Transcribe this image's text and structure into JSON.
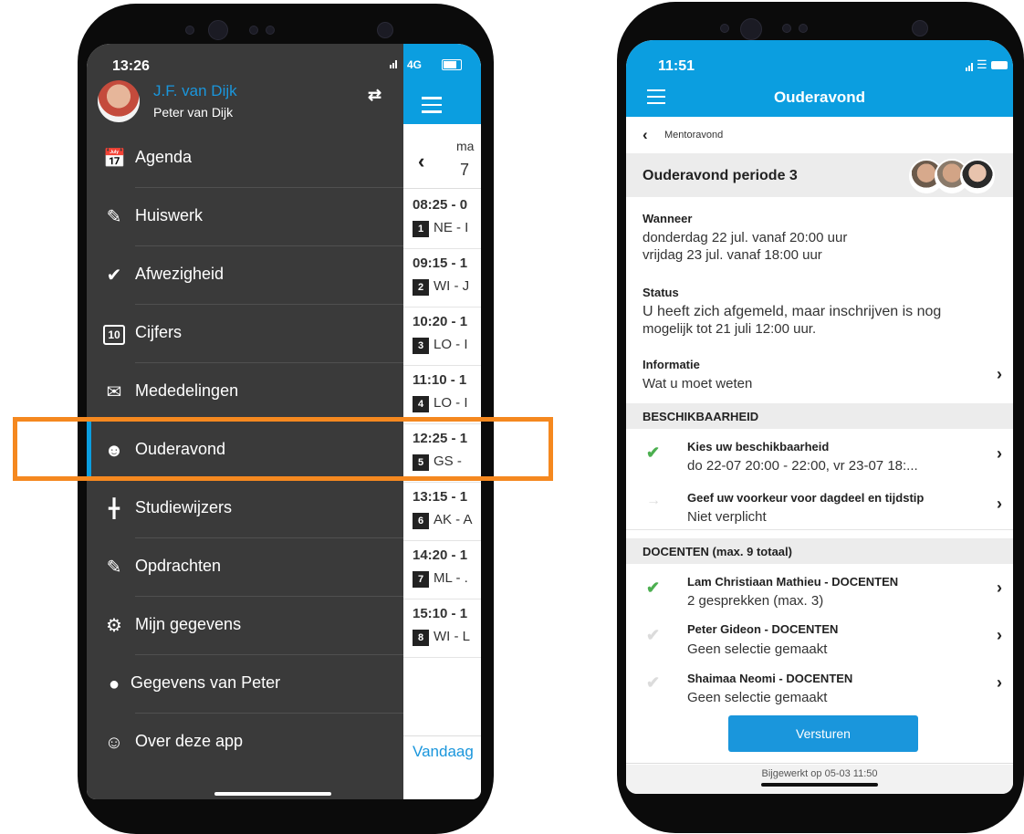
{
  "left_phone": {
    "status": {
      "time": "13:26",
      "network": "4G"
    },
    "profile": {
      "name": "J.F. van Dijk",
      "child": "Peter van Dijk"
    },
    "menu": [
      {
        "label": "Agenda",
        "icon": "calendar-icon"
      },
      {
        "label": "Huiswerk",
        "icon": "edit-icon"
      },
      {
        "label": "Afwezigheid",
        "icon": "check-circle-icon"
      },
      {
        "label": "Cijfers",
        "icon": "grades-icon"
      },
      {
        "label": "Mededelingen",
        "icon": "envelope-icon"
      },
      {
        "label": "Ouderavond",
        "icon": "parents-chat-icon",
        "active": true
      },
      {
        "label": "Studiewijzers",
        "icon": "signpost-icon"
      },
      {
        "label": "Opdrachten",
        "icon": "assignment-icon"
      },
      {
        "label": "Mijn gegevens",
        "icon": "gear-icon"
      },
      {
        "label": "Gegevens van Peter",
        "icon": "person-icon"
      },
      {
        "label": "Over deze app",
        "icon": "group-icon"
      }
    ],
    "behind": {
      "day": "ma",
      "date": "7",
      "rows": [
        {
          "time": "08:25 - 0",
          "badge": "1",
          "sub": "NE - I"
        },
        {
          "time": "09:15 - 1",
          "badge": "2",
          "sub": "WI - J"
        },
        {
          "time": "10:20 - 1",
          "badge": "3",
          "sub": "LO - I"
        },
        {
          "time": "11:10 - 1",
          "badge": "4",
          "sub": "LO - I"
        },
        {
          "time": "12:25 - 1",
          "badge": "5",
          "sub": "GS -"
        },
        {
          "time": "13:15 - 1",
          "badge": "6",
          "sub": "AK - A"
        },
        {
          "time": "14:20 - 1",
          "badge": "7",
          "sub": "ML - ."
        },
        {
          "time": "15:10 - 1",
          "badge": "8",
          "sub": "WI - L"
        }
      ],
      "today": "Vandaag"
    }
  },
  "right_phone": {
    "status": {
      "time": "11:51"
    },
    "title": "Ouderavond",
    "breadcrumb": "Mentoravond",
    "event_title": "Ouderavond periode 3",
    "when": {
      "label": "Wanneer",
      "line1": "donderdag 22 jul. vanaf 20:00 uur",
      "line2": "vrijdag 23 jul. vanaf 18:00 uur"
    },
    "status_info": {
      "label": "Status",
      "line1": "U heeft zich afgemeld, maar inschrijven is nog",
      "line2": "mogelijk tot 21 juli 12:00 uur."
    },
    "info": {
      "label": "Informatie",
      "value": "Wat u moet weten"
    },
    "availability": {
      "header": "BESCHIKBAARHEID",
      "items": [
        {
          "title": "Kies uw beschikbaarheid",
          "value": "do 22-07 20:00 - 22:00, vr 23-07 18:..."
        },
        {
          "title": "Geef uw voorkeur voor dagdeel en tijdstip",
          "value": "Niet verplicht"
        }
      ]
    },
    "teachers": {
      "header": "DOCENTEN (max. 9 totaal)",
      "items": [
        {
          "title": "Lam Christiaan Mathieu - DOCENTEN",
          "value": "2 gesprekken (max. 3)"
        },
        {
          "title": "Peter Gideon  - DOCENTEN",
          "value": "Geen selectie gemaakt"
        },
        {
          "title": "Shaimaa Neomi  - DOCENTEN",
          "value": "Geen selectie gemaakt"
        }
      ]
    },
    "submit_label": "Versturen",
    "footer": "Bijgewerkt op 05-03 11:50"
  },
  "colors": {
    "accent": "#0b9ee0",
    "highlight": "#f5881f",
    "check": "#4caf50",
    "drawer": "#3a3a3a"
  }
}
